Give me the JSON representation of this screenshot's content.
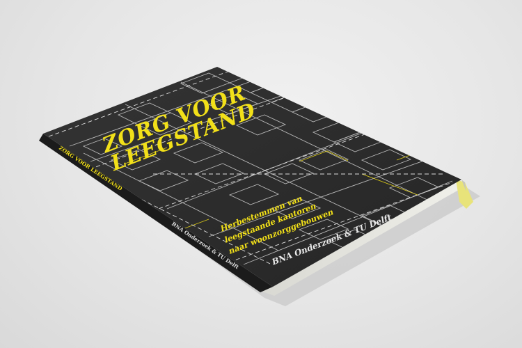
{
  "cover": {
    "title_line_1": "ZORG VOOR",
    "title_line_2": "LEEGSTAND",
    "subtitle_line_1": "Herbestemmen van",
    "subtitle_line_2": "leegstaande kantoren",
    "subtitle_line_3": "naar woonzorggebouwen",
    "publisher": "BNA Onderzoek & TU Delft"
  },
  "spine": {
    "title": "ZORG VOOR LEEGSTAND",
    "author": "BNA Onderzoek & TU Delft"
  },
  "colors": {
    "background": "#e6e6e6",
    "cover_dark": "#2b2b2b",
    "accent_yellow": "#f2e019",
    "pattern_lines": "#b9b9b9"
  }
}
